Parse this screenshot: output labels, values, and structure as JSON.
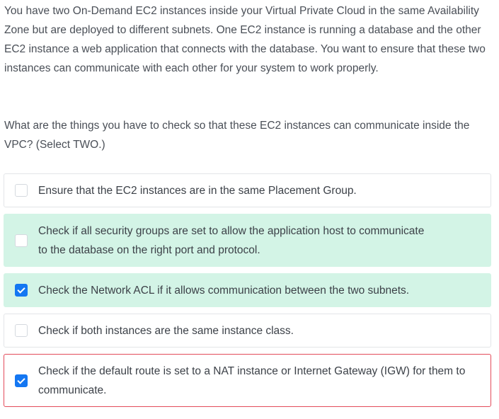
{
  "question": {
    "paragraph1": "You have two On-Demand EC2 instances inside your Virtual Private Cloud in the same Availability Zone but are deployed to different subnets. One EC2 instance is running a database and the other EC2 instance a web application that connects with the database. You want to ensure that these two instances can communicate with each other for your system to work properly.",
    "paragraph2": "What are the things you have to check so that these EC2 instances can communicate inside the VPC? (Select TWO.)"
  },
  "options": [
    {
      "text": "Ensure that the EC2 instances are in the same Placement Group.",
      "checked": false,
      "state": "neutral"
    },
    {
      "text": "Check if all security groups are set to allow the application host to communicate to the database on the right port and protocol.",
      "checked": false,
      "state": "correct"
    },
    {
      "text": "Check the Network ACL if it allows communication between the two subnets.",
      "checked": true,
      "state": "correct"
    },
    {
      "text": "Check if both instances are the same instance class.",
      "checked": false,
      "state": "neutral"
    },
    {
      "text": "Check if the default route is set to a NAT instance or Internet Gateway (IGW) for them to communicate.",
      "checked": true,
      "state": "wrong"
    }
  ],
  "colors": {
    "correct_bg": "#d3f4e6",
    "wrong_border": "#e34b5a",
    "checkbox_checked": "#1477f2"
  }
}
